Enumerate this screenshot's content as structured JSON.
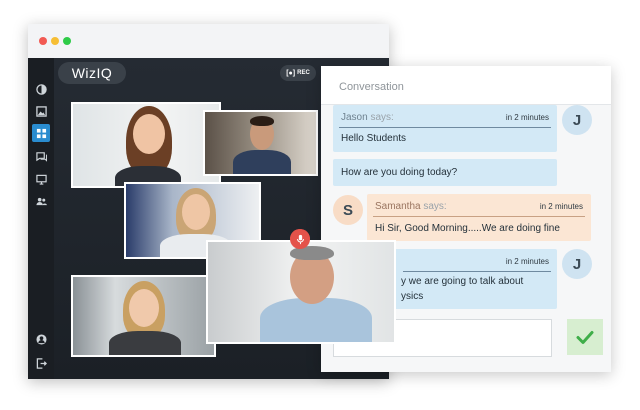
{
  "app": {
    "brand": "WizIQ",
    "rec_label": "REC"
  },
  "sidebar": {
    "items": [
      {
        "icon": "whiteboard-icon",
        "active": false
      },
      {
        "icon": "image-icon",
        "active": false
      },
      {
        "icon": "grid-icon",
        "active": true
      },
      {
        "icon": "chat-icon",
        "active": false
      },
      {
        "icon": "screen-share-icon",
        "active": false
      },
      {
        "icon": "participants-icon",
        "active": false
      },
      {
        "icon": "profile-icon",
        "active": false
      },
      {
        "icon": "logout-icon",
        "active": false
      }
    ]
  },
  "conversation": {
    "title": "Conversation",
    "says_label": "says:",
    "messages": [
      {
        "sender": "Jason",
        "time": "in 2 minutes",
        "avatar": "J",
        "lines": [
          "Hello Students",
          "How are you doing today?"
        ]
      },
      {
        "sender": "Samantha",
        "time": "in 2 minutes",
        "avatar": "S",
        "lines": [
          "Hi Sir, Good Morning.....We are doing fine"
        ]
      },
      {
        "sender": "",
        "time": "in 2 minutes",
        "avatar": "J",
        "lines": [
          "y we are going to talk about",
          "ysics"
        ]
      }
    ],
    "input_placeholder": ""
  },
  "colors": {
    "accent": "#2a8ccf",
    "mic_red": "#e4524a",
    "send_green": "#3fae49",
    "bubble_blue": "#d3e9f6",
    "bubble_peach": "#fbe6d4"
  }
}
